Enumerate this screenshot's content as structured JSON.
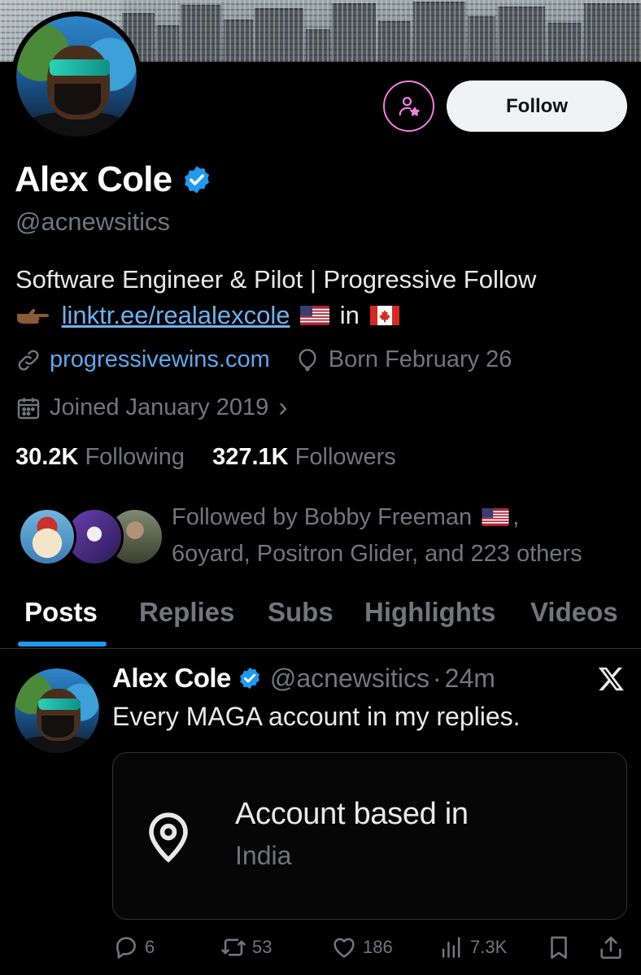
{
  "profile": {
    "name": "Alex Cole",
    "handle": "@acnewsitics",
    "follow_label": "Follow",
    "bio_line1": "Software Engineer & Pilot | Progressive Follow",
    "bio_link": "linktr.ee/realalexcole",
    "bio_in": "in",
    "website": "progressivewins.com",
    "birthday": "Born February 26",
    "joined": "Joined January 2019",
    "joined_chevron": "›",
    "following_count": "30.2K",
    "following_label": "Following",
    "followers_count": "327.1K",
    "followers_label": "Followers",
    "followed_by_line1": "Followed by Bobby Freeman",
    "followed_by_line1_end": ",",
    "followed_by_line2": "6oyard, Positron Glider, and 223 others"
  },
  "tabs": [
    {
      "label": "Posts",
      "active": true
    },
    {
      "label": "Replies",
      "active": false
    },
    {
      "label": "Subs",
      "active": false
    },
    {
      "label": "Highlights",
      "active": false
    },
    {
      "label": "Videos",
      "active": false
    }
  ],
  "post": {
    "author": "Alex Cole",
    "handle": "@acnewsitics",
    "dot": "·",
    "time": "24m",
    "text": "Every MAGA account in my replies.",
    "card_title": "Account based in",
    "card_subtitle": "India",
    "replies": "6",
    "reposts": "53",
    "likes": "186",
    "views": "7.3K"
  },
  "colors": {
    "accent": "#1d9bf0",
    "link": "#6cb2f0",
    "subscribe_ring": "#f17ee0",
    "background": "#000000"
  },
  "icons": [
    "verified-badge-icon",
    "subscribe-icon",
    "link-icon",
    "balloon-icon",
    "calendar-icon",
    "x-logo-icon",
    "location-pin-icon",
    "reply-icon",
    "repost-icon",
    "like-icon",
    "views-icon",
    "bookmark-icon",
    "share-icon"
  ]
}
